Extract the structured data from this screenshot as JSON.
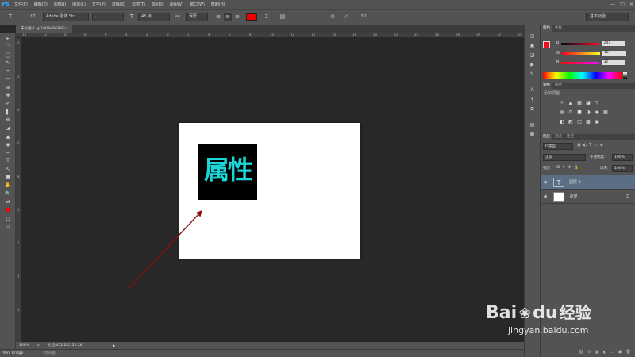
{
  "app": {
    "logo": "Ps",
    "menus": [
      "文件(F)",
      "编辑(E)",
      "图像(I)",
      "图层(L)",
      "文字(Y)",
      "选择(S)",
      "滤镜(T)",
      "3D(D)",
      "视图(V)",
      "窗口(W)",
      "帮助(H)"
    ],
    "window_controls": [
      "—",
      "□",
      "✕"
    ]
  },
  "options": {
    "tool_icon": "T",
    "orient_icon": "↕T",
    "font_family": "Adobe 黑体 Std",
    "font_style": "-",
    "size_icon": "T",
    "font_size": "48 点",
    "aa_icon": "aa",
    "aa_mode": "浑厚",
    "align_icons": [
      "≡",
      "≡",
      "≡"
    ],
    "color": "#ee0000",
    "warp_icon": "⌶",
    "panel_icon": "▤",
    "cancel_icon": "⊘",
    "commit_icon": "✓",
    "three_d_icon": "3D",
    "workspace": "基本功能"
  },
  "document": {
    "tab_title": "未标题-1 @ 100%(RGB/8) *",
    "zoom": "100%",
    "doc_info": "文档:452.2K/122.2K",
    "text_content": "属性",
    "text_color": "#1ad6d6",
    "ruler_top_labels": [
      "14",
      "12",
      "10",
      "8",
      "6",
      "4",
      "2",
      "0",
      "2",
      "4",
      "6",
      "8",
      "10",
      "12",
      "14",
      "16",
      "18",
      "20",
      "22",
      "24",
      "26",
      "28",
      "30",
      "32",
      "34"
    ],
    "ruler_left_labels": [
      "0",
      "2",
      "4",
      "6",
      "8",
      "1",
      "1",
      "1",
      "1"
    ]
  },
  "tools": [
    "▸",
    "⬚",
    "◯",
    "✎",
    "⌗",
    "✂",
    "⊕",
    "✚",
    "✐",
    "▌",
    "✜",
    "◢",
    "▲",
    "◉",
    "✒",
    "T",
    "↖",
    "■",
    "✋",
    "🔍",
    "⇄",
    "■",
    "◻",
    "▭"
  ],
  "panels": {
    "color": {
      "tabs": [
        "颜色",
        "色板"
      ],
      "r_label": "R",
      "r_value": "247",
      "g_label": "G",
      "g_value": "10",
      "b_label": "B",
      "b_value": "32",
      "fg_color": "#f70a20"
    },
    "adjustments": {
      "tabs": [
        "调整",
        "样式"
      ],
      "title": "添加调整",
      "row1": [
        "☀",
        "▲",
        "▦",
        "◪",
        "▽"
      ],
      "row2": [
        "▤",
        "⚖",
        "■",
        "◑",
        "◉",
        "▦"
      ],
      "row3": [
        "◧",
        "◩",
        "◫",
        "▩",
        "▣"
      ]
    },
    "layers": {
      "tabs": [
        "图层",
        "通道",
        "路径"
      ],
      "filter": "P 类型",
      "filter_icons": [
        "▣",
        "◐",
        "T",
        "▭",
        "◈"
      ],
      "blend_mode": "正常",
      "opacity_label": "不透明度:",
      "opacity": "100%",
      "lock_label": "锁定:",
      "lock_icons": [
        "⊠",
        "✎",
        "✥",
        "🔒"
      ],
      "fill_label": "填充:",
      "fill": "100%",
      "items": [
        {
          "name": "图层 1",
          "thumb": "T",
          "selected": true
        },
        {
          "name": "背景",
          "thumb": "",
          "selected": false
        }
      ],
      "footer_icons": [
        "⛓",
        "fx",
        "◧",
        "◐",
        "▭",
        "▣",
        "🗑"
      ]
    }
  },
  "statusbar": {
    "bridge_tab": "Mini Bridge",
    "timeline_tab": "时间轴"
  },
  "watermark": {
    "brand": "Bai",
    "brand2": "du",
    "site_cn": "经验",
    "url": "jingyan.baidu.com"
  }
}
